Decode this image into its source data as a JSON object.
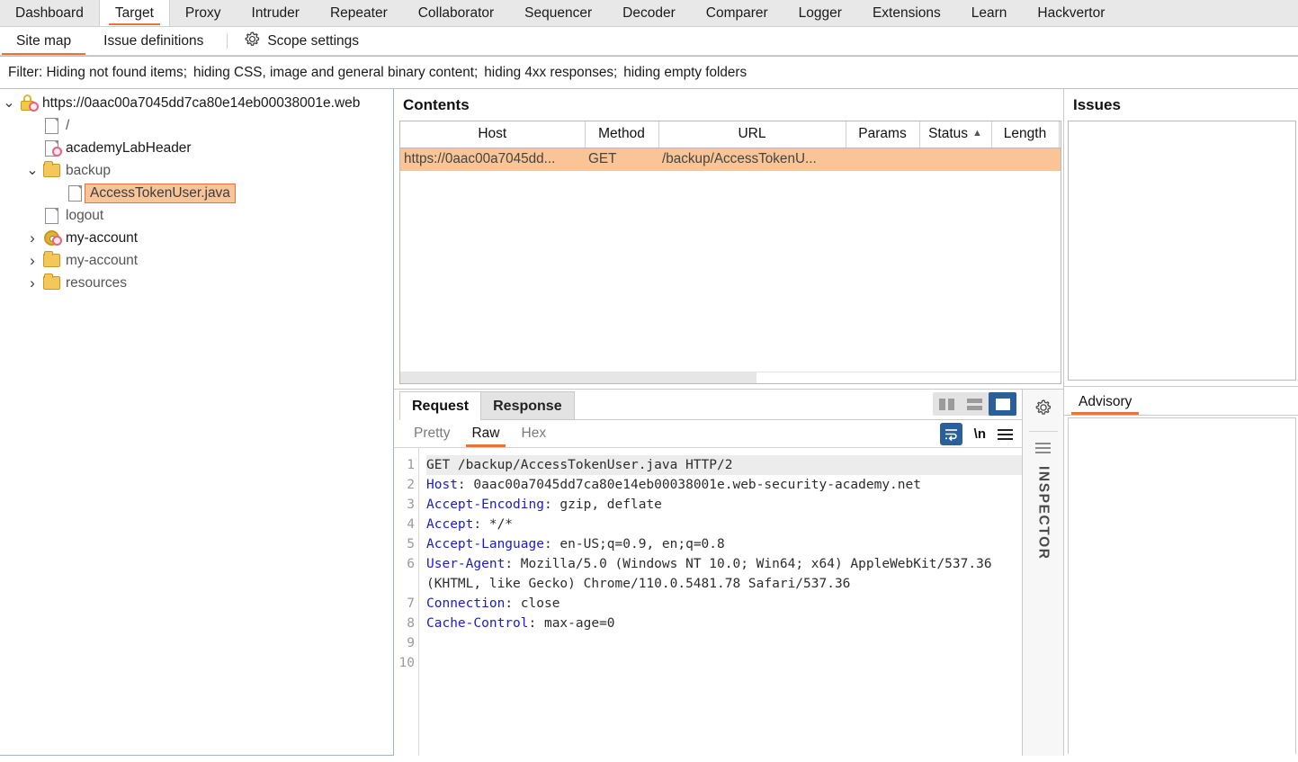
{
  "main_tabs": [
    {
      "label": "Dashboard",
      "active": false
    },
    {
      "label": "Target",
      "active": true
    },
    {
      "label": "Proxy",
      "active": false
    },
    {
      "label": "Intruder",
      "active": false
    },
    {
      "label": "Repeater",
      "active": false
    },
    {
      "label": "Collaborator",
      "active": false
    },
    {
      "label": "Sequencer",
      "active": false
    },
    {
      "label": "Decoder",
      "active": false
    },
    {
      "label": "Comparer",
      "active": false
    },
    {
      "label": "Logger",
      "active": false
    },
    {
      "label": "Extensions",
      "active": false
    },
    {
      "label": "Learn",
      "active": false
    },
    {
      "label": "Hackvertor",
      "active": false
    }
  ],
  "sub_tabs": [
    {
      "label": "Site map",
      "active": true
    },
    {
      "label": "Issue definitions",
      "active": false
    }
  ],
  "scope_settings": {
    "label": "Scope settings",
    "icon": "gear-icon"
  },
  "filter": {
    "prefix": "Filter: Hiding not found items;",
    "parts": [
      "hiding CSS, image and general binary content;",
      "hiding 4xx responses;",
      "hiding empty folders"
    ]
  },
  "site_map": {
    "nodes": [
      {
        "label": "https://0aac00a7045dd7ca80e14eb00038001e.web",
        "icon": "lock-icon",
        "badge": true,
        "twisty": "down",
        "indent": 0,
        "dark": true,
        "selected": false
      },
      {
        "label": "/",
        "icon": "file-icon",
        "badge": false,
        "twisty": "",
        "indent": 1,
        "dark": false,
        "selected": false
      },
      {
        "label": "academyLabHeader",
        "icon": "file-icon",
        "badge": true,
        "twisty": "",
        "indent": 1,
        "dark": true,
        "selected": false
      },
      {
        "label": "backup",
        "icon": "folder-icon",
        "badge": false,
        "twisty": "down",
        "indent": 1,
        "dark": false,
        "selected": false
      },
      {
        "label": "AccessTokenUser.java",
        "icon": "file-icon",
        "badge": false,
        "twisty": "",
        "indent": 2,
        "dark": false,
        "selected": true
      },
      {
        "label": "logout",
        "icon": "file-icon",
        "badge": false,
        "twisty": "",
        "indent": 1,
        "dark": false,
        "selected": false
      },
      {
        "label": "my-account",
        "icon": "gear-node-icon",
        "badge": true,
        "twisty": "right",
        "indent": 1,
        "dark": true,
        "selected": false
      },
      {
        "label": "my-account",
        "icon": "folder-icon",
        "badge": false,
        "twisty": "right",
        "indent": 1,
        "dark": false,
        "selected": false
      },
      {
        "label": "resources",
        "icon": "folder-icon",
        "badge": false,
        "twisty": "right",
        "indent": 1,
        "dark": false,
        "selected": false
      }
    ]
  },
  "contents": {
    "title": "Contents",
    "columns": [
      "Host",
      "Method",
      "URL",
      "Params",
      "Status",
      "Length"
    ],
    "sorted_column": "Status",
    "sort_direction": "ascending",
    "rows": [
      {
        "host": "https://0aac00a7045dd...",
        "method": "GET",
        "url": "/backup/AccessTokenU...",
        "params": "",
        "status": "",
        "length": "",
        "selected": true
      }
    ]
  },
  "editor": {
    "tabs": [
      {
        "label": "Request",
        "active": true
      },
      {
        "label": "Response",
        "active": false
      }
    ],
    "layout_buttons": [
      {
        "name": "side-by-side-layout",
        "active": false
      },
      {
        "name": "stacked-layout",
        "active": false
      },
      {
        "name": "single-pane-layout",
        "active": true
      }
    ],
    "format_tabs": [
      {
        "label": "Pretty",
        "active": false
      },
      {
        "label": "Raw",
        "active": true
      },
      {
        "label": "Hex",
        "active": false
      }
    ],
    "tools": [
      {
        "name": "word-wrap-toggle",
        "label": "",
        "active": true
      },
      {
        "name": "show-newlines-toggle",
        "label": "\\n",
        "active": false
      },
      {
        "name": "editor-menu-button",
        "label": "",
        "active": false
      }
    ],
    "request_lines": [
      {
        "num": "1",
        "header": "",
        "rest": "GET /backup/AccessTokenUser.java HTTP/2",
        "highlight": true
      },
      {
        "num": "2",
        "header": "Host",
        "rest": ": 0aac00a7045dd7ca80e14eb00038001e.web-security-academy.net",
        "highlight": false
      },
      {
        "num": "3",
        "header": "Accept-Encoding",
        "rest": ": gzip, deflate",
        "highlight": false
      },
      {
        "num": "4",
        "header": "Accept",
        "rest": ": */*",
        "highlight": false
      },
      {
        "num": "5",
        "header": "Accept-Language",
        "rest": ": en-US;q=0.9, en;q=0.8",
        "highlight": false
      },
      {
        "num": "6",
        "header": "User-Agent",
        "rest": ": Mozilla/5.0 (Windows NT 10.0; Win64; x64) AppleWebKit/537.36 (KHTML, like Gecko) Chrome/110.0.5481.78 Safari/537.36",
        "highlight": false
      },
      {
        "num": "7",
        "header": "Connection",
        "rest": ": close",
        "highlight": false
      },
      {
        "num": "8",
        "header": "Cache-Control",
        "rest": ": max-age=0",
        "highlight": false
      },
      {
        "num": "9",
        "header": "",
        "rest": "",
        "highlight": false
      },
      {
        "num": "10",
        "header": "",
        "rest": "",
        "highlight": false
      }
    ],
    "gutter_numbers": "1\n2\n3\n4\n5\n6\n\n\n7\n8\n9\n10"
  },
  "inspector": {
    "label": "INSPECTOR",
    "gear": "gear-icon"
  },
  "issues": {
    "title": "Issues",
    "items": []
  },
  "advisory": {
    "tabs": [
      {
        "label": "Advisory",
        "active": true
      }
    ],
    "body": ""
  },
  "colors": {
    "accent_orange": "#e8743b",
    "selection_peach": "#f9c596",
    "active_blue": "#2a6099",
    "header_text": "#1a1ad1"
  }
}
